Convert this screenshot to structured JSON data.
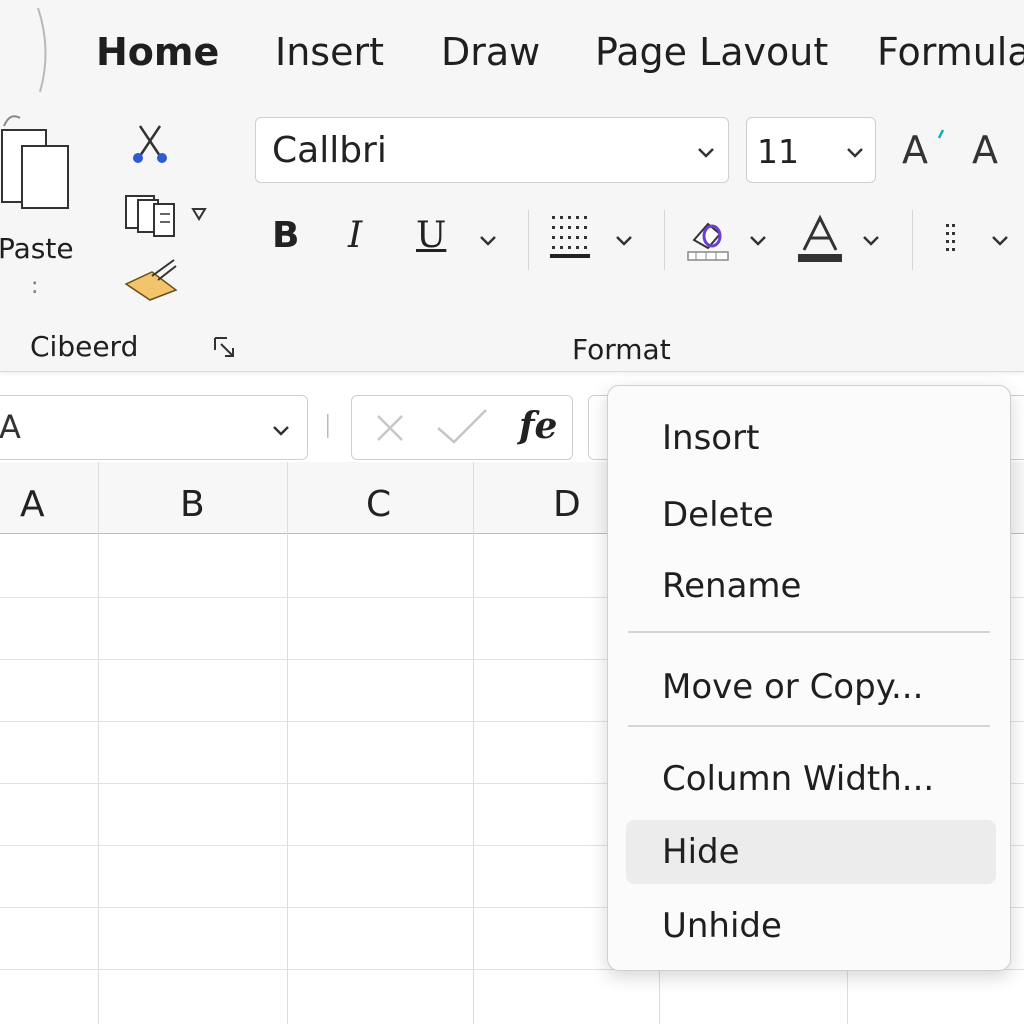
{
  "ribbon": {
    "tabs": [
      {
        "label": "Home",
        "active": true
      },
      {
        "label": "Insert",
        "active": false
      },
      {
        "label": "Draw",
        "active": false
      },
      {
        "label": "Page Lavout",
        "active": false
      },
      {
        "label": "Formula",
        "active": false
      }
    ],
    "clipboard": {
      "paste_label": "Paste",
      "dots": ":",
      "group_label": "Cibeerd"
    },
    "font": {
      "name": "Callbri",
      "size": "11",
      "grow_label": "A",
      "shrink_label": "A",
      "bold_label": "B",
      "italic_label": "I",
      "underline_label": "U",
      "group_label": "Format"
    },
    "colors": {
      "accent_blue": "#1e6fe0",
      "highlight_yellow": "#f2c46b",
      "font_color_bar": "#333333"
    }
  },
  "formula_bar": {
    "name_box": "A",
    "fx_label": "fe"
  },
  "grid": {
    "columns": [
      "A",
      "B",
      "C",
      "D"
    ]
  },
  "context_menu": {
    "items": [
      "Insort",
      "Delete",
      "Rename",
      "Move or Copy...",
      "Column Width...",
      "Hide",
      "Unhide"
    ],
    "hovered": "Hide"
  }
}
